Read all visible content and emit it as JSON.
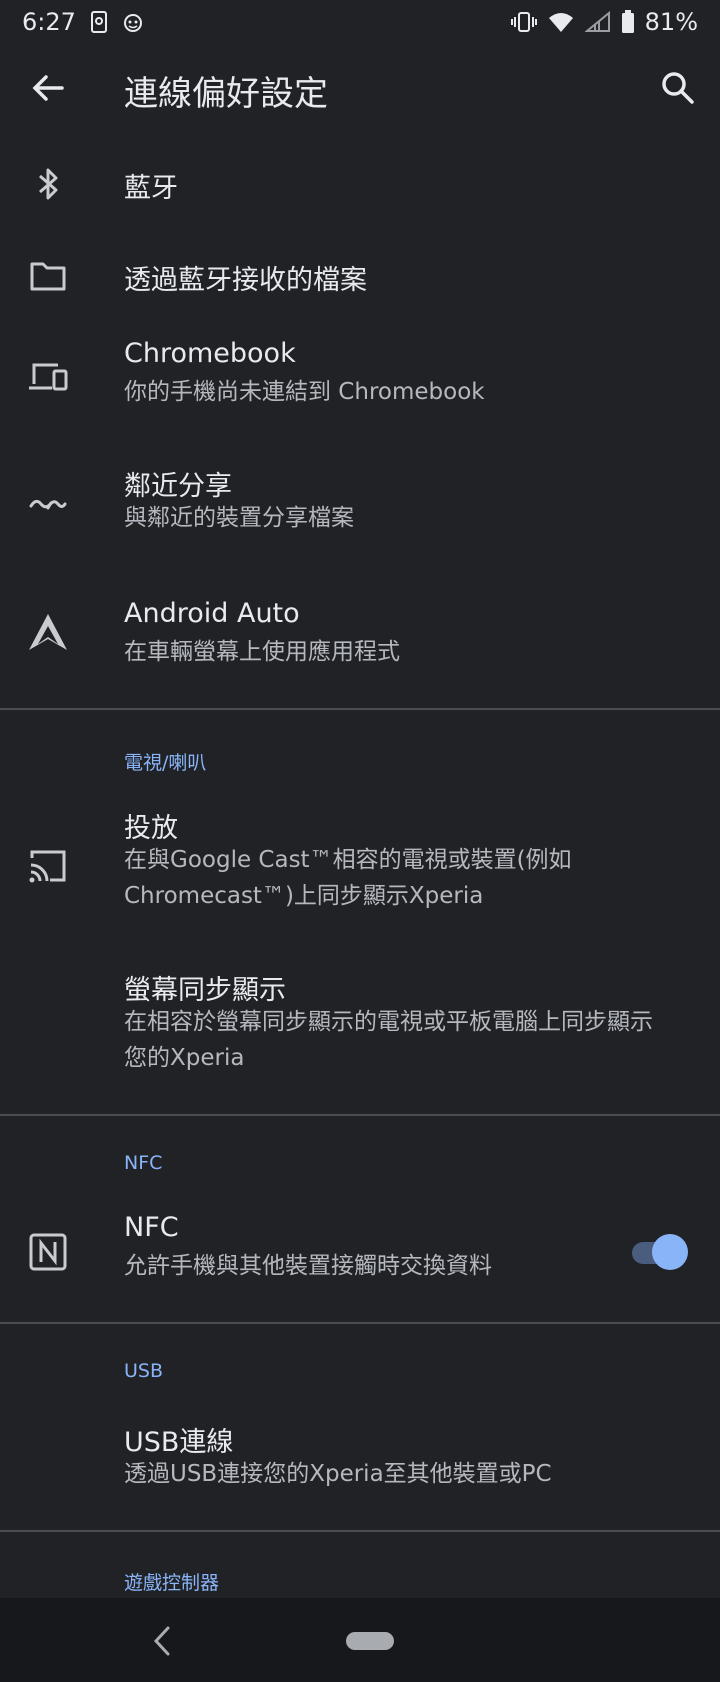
{
  "status_bar": {
    "time": "6:27",
    "battery": "81%",
    "icons": [
      "screenshot-icon",
      "face-icon",
      "vibrate-icon",
      "wifi-icon",
      "signal-icon",
      "battery-icon"
    ]
  },
  "app_bar": {
    "title": "連線偏好設定",
    "back_icon": "arrow-back-icon",
    "search_icon": "search-icon"
  },
  "items": {
    "bluetooth": {
      "title": "藍牙",
      "icon": "bluetooth-icon"
    },
    "received_files": {
      "title": "透過藍牙接收的檔案",
      "icon": "folder-icon"
    },
    "chromebook": {
      "title": "Chromebook",
      "subtitle": "你的手機尚未連結到 Chromebook",
      "icon": "devices-icon"
    },
    "nearby_share": {
      "title": "鄰近分享",
      "subtitle": "與鄰近的裝置分享檔案",
      "icon": "nearby-share-icon"
    },
    "android_auto": {
      "title": "Android Auto",
      "subtitle": "在車輛螢幕上使用應用程式",
      "icon": "android-auto-icon"
    }
  },
  "sections": {
    "tv_speaker": {
      "label": "電視/喇叭",
      "cast": {
        "title": "投放",
        "subtitle_line1": "在與Google Cast™相容的電視或裝置(例如",
        "subtitle_line2": "Chromecast™)上同步顯示Xperia",
        "icon": "cast-icon"
      },
      "mirroring": {
        "title": "螢幕同步顯示",
        "subtitle_line1": "在相容於螢幕同步顯示的電視或平板電腦上同步顯示",
        "subtitle_line2": "您的Xperia"
      }
    },
    "nfc": {
      "label": "NFC",
      "nfc_item": {
        "title": "NFC",
        "subtitle": "允許手機與其他裝置接觸時交換資料",
        "icon": "nfc-icon",
        "enabled": true
      }
    },
    "usb": {
      "label": "USB",
      "usb_item": {
        "title": "USB連線",
        "subtitle": "透過USB連接您的Xperia至其他裝置或PC"
      }
    },
    "game_controller": {
      "label": "遊戲控制器"
    }
  },
  "colors": {
    "background": "#202226",
    "accent": "#8ab4f8",
    "text_primary": "#e8eaed",
    "text_secondary": "#b5b9bf",
    "divider": "#4a4d52"
  }
}
